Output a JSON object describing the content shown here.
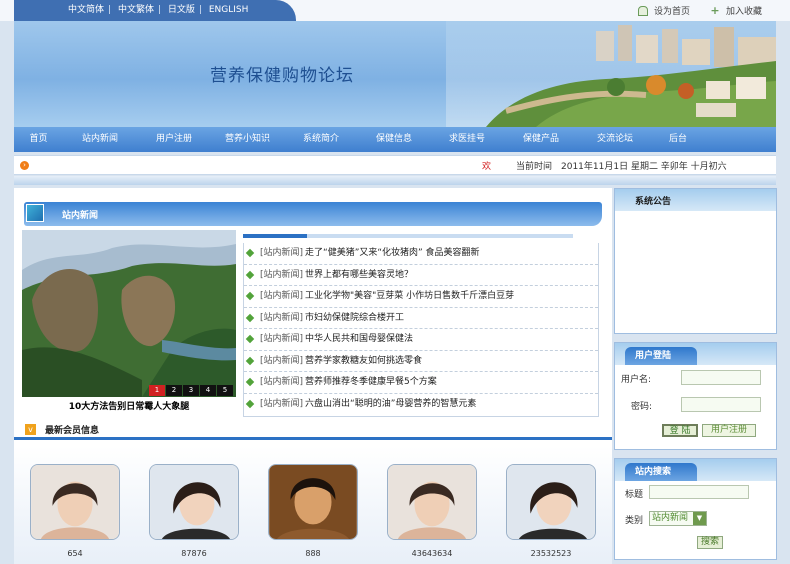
{
  "lang_links": [
    "中文简体",
    "中文繁体",
    "日文版",
    "ENGLISH"
  ],
  "top_links": {
    "home": "设为首页",
    "favorite": "加入收藏"
  },
  "banner": {
    "title": "营养保健购物论坛"
  },
  "nav": [
    "首页",
    "站内新闻",
    "用户注册",
    "营养小知识",
    "系统简介",
    "保健信息",
    "求医挂号",
    "保健产品",
    "交流论坛",
    "后台"
  ],
  "date_bar": {
    "welcome": "欢",
    "date_text": "当前时间　2011年11月1日 星期二 辛卯年 十月初六"
  },
  "news": {
    "heading": "站内新闻",
    "photo_caption": "10大方法告别日常霉人大象腿",
    "pager": [
      "1",
      "2",
      "3",
      "4",
      "5"
    ],
    "items": [
      {
        "tag": "[站内新闻]",
        "title": "走了“健美猪”又来“化妆猪肉” 食品美容翻新"
      },
      {
        "tag": "[站内新闻]",
        "title": "世界上都有哪些美容灵地？"
      },
      {
        "tag": "[站内新闻]",
        "title": "工业化学物\"美容\"豆芽菜 小作坊日售数千斤漂白豆芽"
      },
      {
        "tag": "[站内新闻]",
        "title": "市妇幼保健院综合楼开工"
      },
      {
        "tag": "[站内新闻]",
        "title": "中华人民共和国母婴保健法"
      },
      {
        "tag": "[站内新闻]",
        "title": "营养学家教糖友如何挑选零食"
      },
      {
        "tag": "[站内新闻]",
        "title": "营养师推荐冬季健康早餐5个方案"
      },
      {
        "tag": "[站内新闻]",
        "title": "六盘山消出“聪明的油”母婴营养的智慧元素"
      }
    ]
  },
  "members": {
    "heading": "最新会员信息",
    "list": [
      {
        "name": "654"
      },
      {
        "name": "87876"
      },
      {
        "name": "888"
      },
      {
        "name": "43643634"
      },
      {
        "name": "23532523"
      }
    ]
  },
  "sidebar": {
    "notice_title": "系统公告",
    "login": {
      "title": "用户登陆",
      "username_label": "用户名:",
      "password_label": "密码:",
      "login_button": "登 陆",
      "register_button": "用户注册"
    },
    "search": {
      "title": "站内搜索",
      "keyword_label": "标题",
      "category_label": "类别",
      "category_value": "站内新闻",
      "search_button": "搜索"
    }
  },
  "colors": {
    "nav_blue": "#3f7fcf",
    "accent_orange": "#f07d16",
    "pager_active": "#d12121"
  }
}
